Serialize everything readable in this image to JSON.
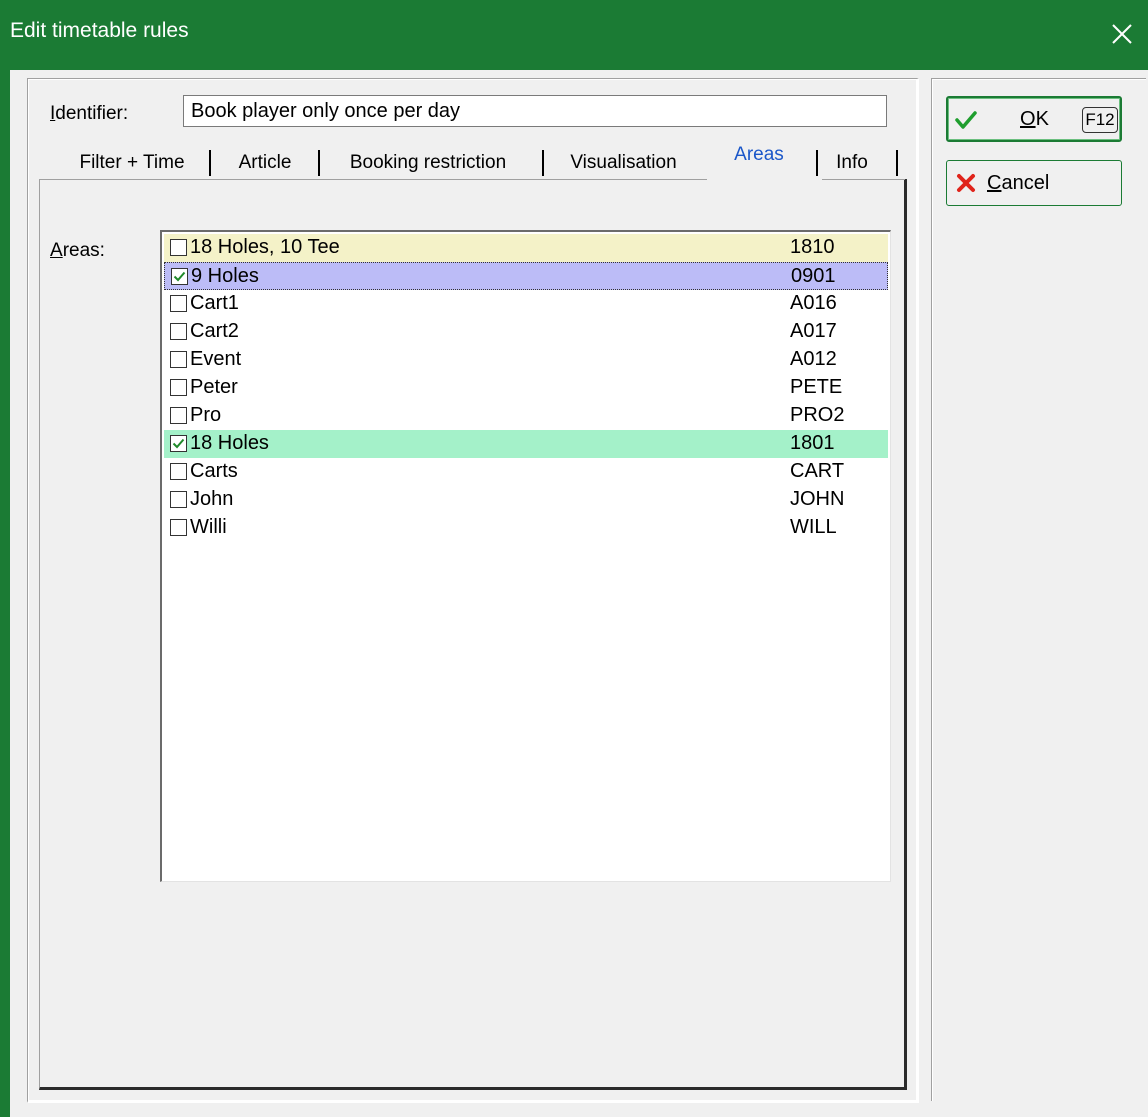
{
  "window": {
    "title": "Edit timetable rules"
  },
  "identifier": {
    "label": "Identifier:",
    "value": "Book player only once per day"
  },
  "tabs": [
    {
      "label": "Filter + Time",
      "active": false
    },
    {
      "label": "Article",
      "active": false
    },
    {
      "label": "Booking restriction",
      "active": false
    },
    {
      "label": "Visualisation",
      "active": false
    },
    {
      "label": "Areas",
      "active": true
    },
    {
      "label": "Info",
      "active": false
    }
  ],
  "areas": {
    "label": "Areas:",
    "items": [
      {
        "name": "18 Holes, 10 Tee",
        "code": "1810",
        "checked": false,
        "highlight": "yellow"
      },
      {
        "name": "9 Holes",
        "code": "0901",
        "checked": true,
        "highlight": "blue"
      },
      {
        "name": "Cart1",
        "code": "A016",
        "checked": false,
        "highlight": ""
      },
      {
        "name": "Cart2",
        "code": "A017",
        "checked": false,
        "highlight": ""
      },
      {
        "name": "Event",
        "code": "A012",
        "checked": false,
        "highlight": ""
      },
      {
        "name": "Peter",
        "code": "PETE",
        "checked": false,
        "highlight": ""
      },
      {
        "name": "Pro",
        "code": "PRO2",
        "checked": false,
        "highlight": ""
      },
      {
        "name": "18 Holes",
        "code": "1801",
        "checked": true,
        "highlight": "green"
      },
      {
        "name": "Carts",
        "code": "CART",
        "checked": false,
        "highlight": ""
      },
      {
        "name": "John",
        "code": "JOHN",
        "checked": false,
        "highlight": ""
      },
      {
        "name": "Willi",
        "code": "WILL",
        "checked": false,
        "highlight": ""
      }
    ]
  },
  "buttons": {
    "ok": {
      "label": "OK",
      "shortcut": "F12"
    },
    "cancel": {
      "label": "Cancel"
    }
  },
  "colors": {
    "titlebar": "#1b7b34",
    "active_tab": "#1b57c9",
    "row_yellow": "#f4f2c8",
    "row_blue": "#bcbcf7",
    "row_green": "#a4f1c9",
    "ok_check": "#1f9e2e",
    "cancel_x": "#e0241b"
  }
}
